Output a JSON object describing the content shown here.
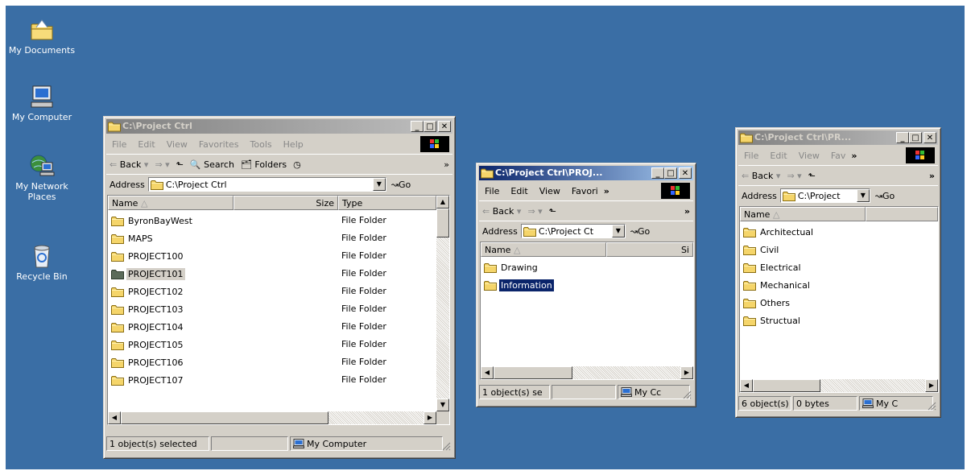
{
  "desktop": {
    "icons": [
      {
        "label": "My Documents",
        "icon": "my-documents-icon"
      },
      {
        "label": "My Computer",
        "icon": "my-computer-icon"
      },
      {
        "label": "My Network Places",
        "icon": "network-places-icon"
      },
      {
        "label": "Recycle Bin",
        "icon": "recycle-bin-icon"
      }
    ],
    "background": "#3a6ea5"
  },
  "win1": {
    "title": "C:\\Project Ctrl",
    "menu": [
      "File",
      "Edit",
      "View",
      "Favorites",
      "Tools",
      "Help"
    ],
    "toolbar": {
      "back": "Back",
      "search": "Search",
      "folders": "Folders",
      "more": "»"
    },
    "address_label": "Address",
    "address_value": "C:\\Project Ctrl",
    "go_label": "Go",
    "columns": {
      "name": "Name",
      "size": "Size",
      "type": "Type"
    },
    "rows": [
      {
        "name": "ByronBayWest",
        "type": "File Folder"
      },
      {
        "name": "MAPS",
        "type": "File Folder"
      },
      {
        "name": "PROJECT100",
        "type": "File Folder"
      },
      {
        "name": "PROJECT101",
        "type": "File Folder"
      },
      {
        "name": "PROJECT102",
        "type": "File Folder"
      },
      {
        "name": "PROJECT103",
        "type": "File Folder"
      },
      {
        "name": "PROJECT104",
        "type": "File Folder"
      },
      {
        "name": "PROJECT105",
        "type": "File Folder"
      },
      {
        "name": "PROJECT106",
        "type": "File Folder"
      },
      {
        "name": "PROJECT107",
        "type": "File Folder"
      }
    ],
    "selected_row": "PROJECT101",
    "status": {
      "left": "1 object(s) selected",
      "zone": "My Computer"
    }
  },
  "win2": {
    "title": "C:\\Project Ctrl\\PROJ...",
    "menu": [
      "File",
      "Edit",
      "View",
      "Favori"
    ],
    "more": "»",
    "toolbar": {
      "back": "Back",
      "more": "»"
    },
    "address_label": "Address",
    "address_value": "C:\\Project Ct",
    "go_label": "Go",
    "columns": {
      "name": "Name",
      "size": "Si"
    },
    "rows": [
      {
        "name": "Drawing"
      },
      {
        "name": "Information"
      }
    ],
    "selected_row": "Information",
    "status": {
      "left": "1 object(s) se",
      "zone": "My Cc"
    }
  },
  "win3": {
    "title": "C:\\Project Ctrl\\PR...",
    "menu": [
      "File",
      "Edit",
      "View",
      "Fav"
    ],
    "more": "»",
    "toolbar": {
      "back": "Back",
      "more": "»"
    },
    "address_label": "Address",
    "address_value": "C:\\Project",
    "go_label": "Go",
    "columns": {
      "name": "Name"
    },
    "rows": [
      {
        "name": "Architectual"
      },
      {
        "name": "Civil"
      },
      {
        "name": "Electrical"
      },
      {
        "name": "Mechanical"
      },
      {
        "name": "Others"
      },
      {
        "name": "Structual"
      }
    ],
    "status": {
      "left": "6 object(s)",
      "size": "0 bytes",
      "zone": "My C"
    }
  }
}
